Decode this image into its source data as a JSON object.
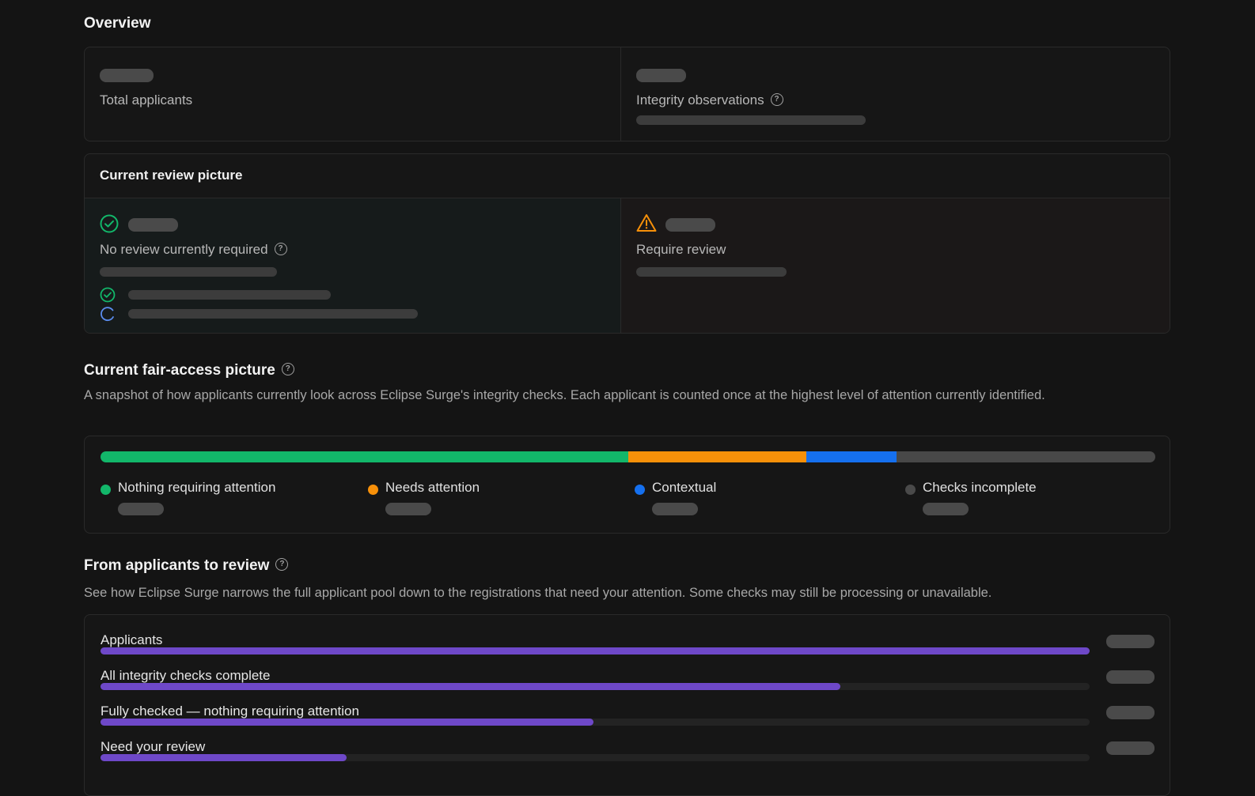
{
  "overview": {
    "title": "Overview",
    "total_applicants_label": "Total applicants",
    "integrity_observations_label": "Integrity observations"
  },
  "review_picture": {
    "title": "Current review picture",
    "no_review_label": "No review currently required",
    "require_review_label": "Require review"
  },
  "fair_access": {
    "title": "Current fair-access picture",
    "description": "A snapshot of how applicants currently look across Eclipse Surge's integrity checks. Each applicant is counted once at the highest level of attention currently identified.",
    "segments": [
      {
        "name": "Nothing requiring attention",
        "fraction": 0.5,
        "color": "#12b76a"
      },
      {
        "name": "Needs attention",
        "fraction": 0.169,
        "color": "#f79009"
      },
      {
        "name": "Contextual",
        "fraction": 0.086,
        "color": "#1570ef"
      },
      {
        "name": "Checks incomplete",
        "fraction": 0.245,
        "color": "#484848"
      }
    ],
    "legend": [
      {
        "label": "Nothing requiring attention",
        "color": "#12b76a"
      },
      {
        "label": "Needs attention",
        "color": "#f79009"
      },
      {
        "label": "Contextual",
        "color": "#1570ef"
      },
      {
        "label": "Checks incomplete",
        "color": "#4a4a4a"
      }
    ]
  },
  "funnel": {
    "title": "From applicants to review",
    "description": "See how Eclipse Surge narrows the full applicant pool down to the registrations that need your attention. Some checks may still be processing or unavailable.",
    "bar_color": "#6e48c8",
    "rows": [
      {
        "label": "Applicants",
        "fraction": 1.0
      },
      {
        "label": "All integrity checks complete",
        "fraction": 0.748
      },
      {
        "label": "Fully checked — nothing requiring attention",
        "fraction": 0.498
      },
      {
        "label": "Need your review",
        "fraction": 0.249
      }
    ]
  },
  "colors": {
    "success": "#12b76a",
    "warning": "#f79009",
    "info": "#5b8def",
    "background": "#141414"
  },
  "icons": [
    "help-icon",
    "check-circle-icon",
    "warning-triangle-icon",
    "spinner-icon"
  ]
}
